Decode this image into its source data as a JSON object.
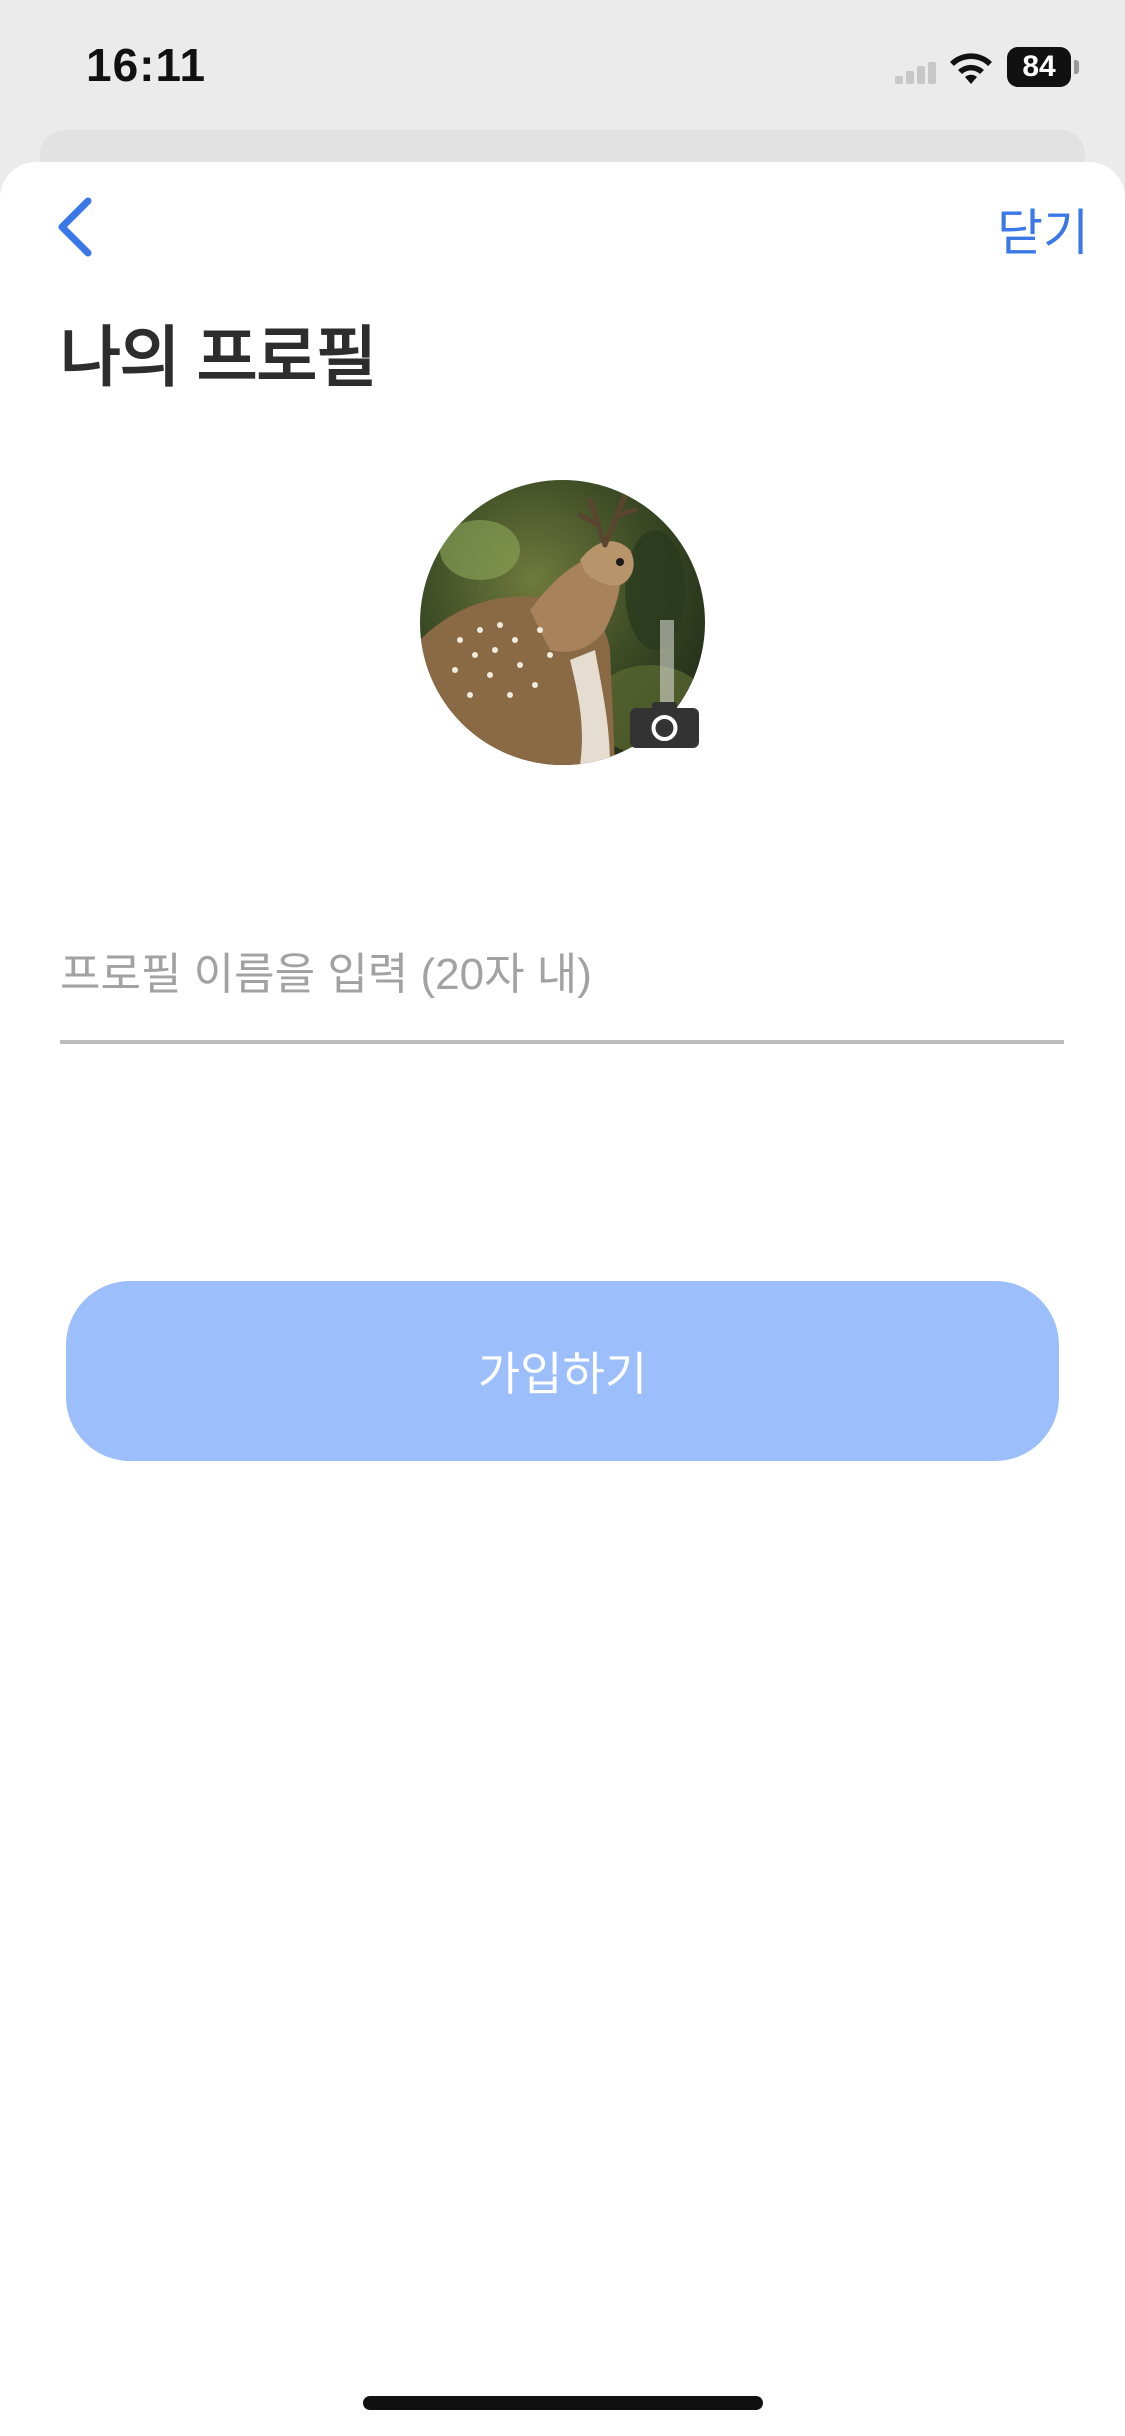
{
  "status_bar": {
    "time": "16:11",
    "battery_level": "84",
    "icons": [
      "signal-icon",
      "wifi-icon",
      "battery-icon"
    ]
  },
  "header": {
    "back_icon": "chevron-left-icon",
    "close_label": "닫기",
    "title": "나의 프로필"
  },
  "profile": {
    "avatar_alt": "deer photo",
    "camera_icon": "camera-icon"
  },
  "form": {
    "name_placeholder": "프로필 이름을 입력 (20자 내)",
    "name_value": ""
  },
  "actions": {
    "signup_label": "가입하기"
  },
  "colors": {
    "accent": "#3a78e8",
    "button_disabled": "#9cbffb",
    "title": "#2d2d2d",
    "placeholder": "#a2a2a2"
  }
}
